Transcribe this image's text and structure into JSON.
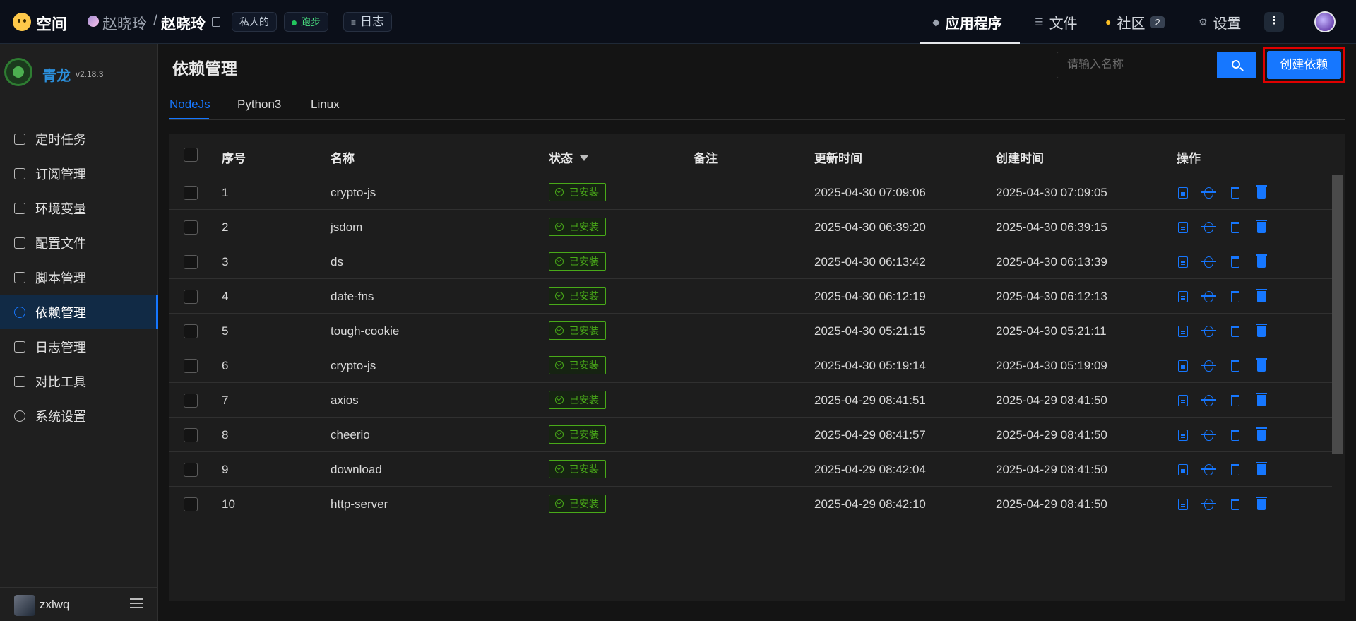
{
  "topbar": {
    "brand": "空间",
    "owner": "赵晓玲",
    "slash": "/",
    "repo": "赵晓玲",
    "tags": {
      "private": "私人的",
      "running": "跑步",
      "logs": "日志"
    },
    "nav": {
      "app": "应用程序",
      "files": "文件",
      "community": "社区",
      "community_badge": "2",
      "settings": "设置"
    },
    "more": "⋮"
  },
  "sidebar": {
    "app_name": "青龙",
    "version": "v2.18.3",
    "items": [
      {
        "label": "定时任务",
        "icon": "calendar-icon"
      },
      {
        "label": "订阅管理",
        "icon": "subscribe-icon"
      },
      {
        "label": "环境变量",
        "icon": "desktop-icon"
      },
      {
        "label": "配置文件",
        "icon": "sliders-icon"
      },
      {
        "label": "脚本管理",
        "icon": "code-icon"
      },
      {
        "label": "依赖管理",
        "icon": "package-icon",
        "active": true
      },
      {
        "label": "日志管理",
        "icon": "log-icon"
      },
      {
        "label": "对比工具",
        "icon": "diff-icon"
      },
      {
        "label": "系统设置",
        "icon": "gear-icon"
      }
    ],
    "user": "zxlwq"
  },
  "main": {
    "title": "依赖管理",
    "search_placeholder": "请输入名称",
    "create_label": "创建依赖",
    "tabs": [
      "NodeJs",
      "Python3",
      "Linux"
    ],
    "active_tab": "NodeJs"
  },
  "table": {
    "headers": {
      "index": "序号",
      "name": "名称",
      "status": "状态",
      "remark": "备注",
      "updated": "更新时间",
      "created": "创建时间",
      "actions": "操作"
    },
    "status_label": "已安装",
    "rows": [
      {
        "index": "1",
        "name": "crypto-js",
        "updated": "2025-04-30 07:09:06",
        "created": "2025-04-30 07:09:05"
      },
      {
        "index": "2",
        "name": "jsdom",
        "updated": "2025-04-30 06:39:20",
        "created": "2025-04-30 06:39:15"
      },
      {
        "index": "3",
        "name": "ds",
        "updated": "2025-04-30 06:13:42",
        "created": "2025-04-30 06:13:39"
      },
      {
        "index": "4",
        "name": "date-fns",
        "updated": "2025-04-30 06:12:19",
        "created": "2025-04-30 06:12:13"
      },
      {
        "index": "5",
        "name": "tough-cookie",
        "updated": "2025-04-30 05:21:15",
        "created": "2025-04-30 05:21:11"
      },
      {
        "index": "6",
        "name": "crypto-js",
        "updated": "2025-04-30 05:19:14",
        "created": "2025-04-30 05:19:09"
      },
      {
        "index": "7",
        "name": "axios",
        "updated": "2025-04-29 08:41:51",
        "created": "2025-04-29 08:41:50"
      },
      {
        "index": "8",
        "name": "cheerio",
        "updated": "2025-04-29 08:41:57",
        "created": "2025-04-29 08:41:50"
      },
      {
        "index": "9",
        "name": "download",
        "updated": "2025-04-29 08:42:04",
        "created": "2025-04-29 08:41:50"
      },
      {
        "index": "10",
        "name": "http-server",
        "updated": "2025-04-29 08:42:10",
        "created": "2025-04-29 08:41:50"
      }
    ]
  },
  "colors": {
    "accent": "#1677ff",
    "installed": "#49aa19",
    "highlight": "#e00000"
  }
}
